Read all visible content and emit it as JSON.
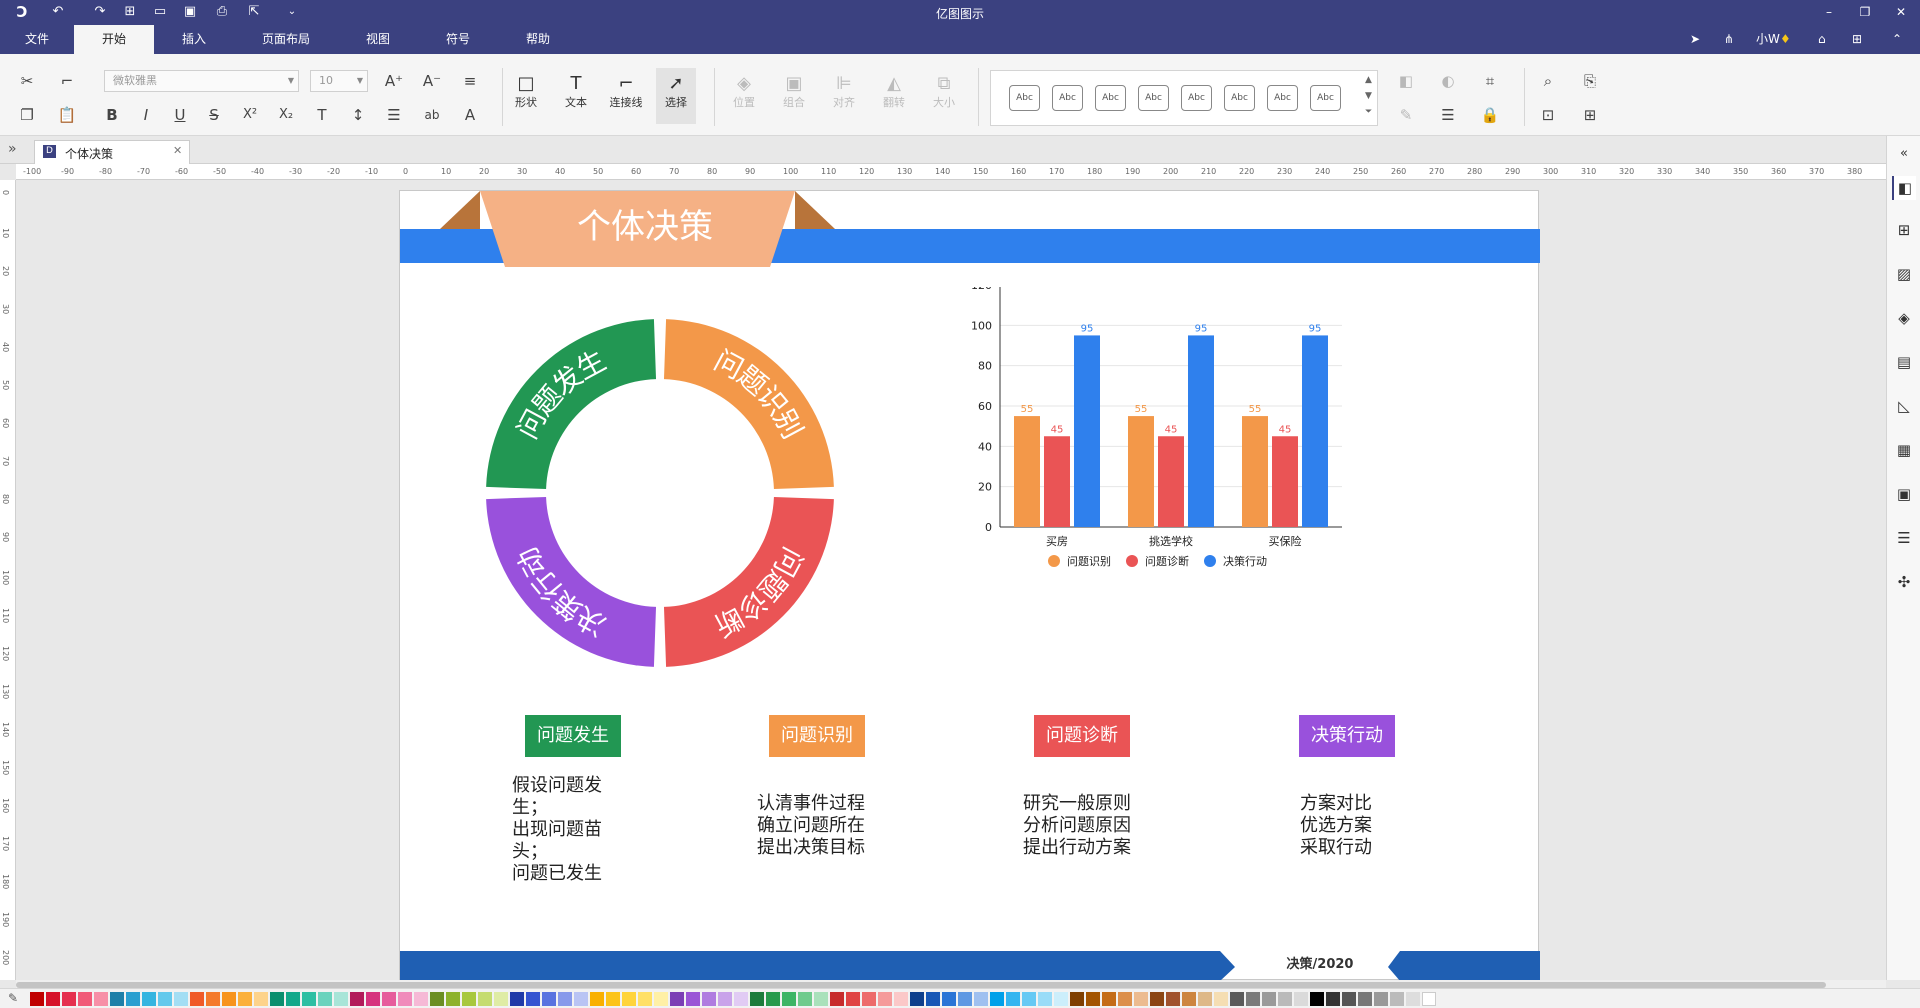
{
  "app": {
    "title": "亿图图示"
  },
  "menu": {
    "tabs": [
      "文件",
      "开始",
      "插入",
      "页面布局",
      "视图",
      "符号",
      "帮助"
    ],
    "active": "开始"
  },
  "user": {
    "name": "小W"
  },
  "ribbon": {
    "font_name": "微软雅黑",
    "font_size": "10",
    "big_buttons": [
      "形状",
      "文本",
      "连接线",
      "选择",
      "位置",
      "组合",
      "对齐",
      "翻转",
      "大小"
    ],
    "style_samples": [
      "Abc",
      "Abc",
      "Abc",
      "Abc",
      "Abc",
      "Abc",
      "Abc",
      "Abc"
    ]
  },
  "doc_tab": {
    "label": "个体决策"
  },
  "ruler": {
    "h": [
      "-100",
      "-90",
      "-80",
      "-70",
      "-60",
      "-50",
      "-40",
      "-30",
      "-20",
      "-10",
      "0",
      "10",
      "20",
      "30",
      "40",
      "50",
      "60",
      "70",
      "80",
      "90",
      "100",
      "110",
      "120",
      "130",
      "140",
      "150",
      "160",
      "170",
      "180",
      "190",
      "200",
      "210",
      "220",
      "230",
      "240",
      "250",
      "260",
      "270",
      "280",
      "290",
      "300",
      "310",
      "320",
      "330",
      "340",
      "350",
      "360",
      "370",
      "380"
    ],
    "v": [
      "0",
      "10",
      "20",
      "30",
      "40",
      "50",
      "60",
      "70",
      "80",
      "90",
      "100",
      "110",
      "120",
      "130",
      "140",
      "150",
      "160",
      "170",
      "180",
      "190",
      "200"
    ]
  },
  "diagram": {
    "title": "个体决策",
    "footer": "决策/2020",
    "ring": [
      "问题发生",
      "问题识别",
      "问题诊断",
      "决策行动"
    ],
    "ring_colors": [
      "#229753",
      "#f39849",
      "#ea5455",
      "#9951dc"
    ],
    "stages": [
      {
        "label": "问题发生",
        "color": "#229753",
        "desc": "假设问题发\n生；\n出现问题苗\n头；\n问题已发生"
      },
      {
        "label": "问题识别",
        "color": "#f39849",
        "desc": "认清事件过程\n确立问题所在\n提出决策目标"
      },
      {
        "label": "问题诊断",
        "color": "#ea5455",
        "desc": "研究一般原则\n分析问题原因\n提出行动方案"
      },
      {
        "label": "决策行动",
        "color": "#9951dc",
        "desc": "方案对比\n优选方案\n采取行动"
      }
    ]
  },
  "chart_data": {
    "type": "bar",
    "categories": [
      "买房",
      "挑选学校",
      "买保险"
    ],
    "series": [
      {
        "name": "问题识别",
        "color": "#f39849",
        "values": [
          55,
          55,
          55
        ]
      },
      {
        "name": "问题诊断",
        "color": "#ea5455",
        "values": [
          45,
          45,
          45
        ]
      },
      {
        "name": "决策行动",
        "color": "#2f80ed",
        "values": [
          95,
          95,
          95
        ]
      }
    ],
    "ylim": [
      0,
      120
    ],
    "yticks": [
      "0",
      "20",
      "40",
      "60",
      "80",
      "100",
      "120"
    ],
    "grid": true,
    "legend": "bottom",
    "data_labels": true
  },
  "palette": [
    "#c00000",
    "#d6122a",
    "#e5304f",
    "#f15a78",
    "#f78fa7",
    "#1e7fa8",
    "#2a9fd0",
    "#35b5e0",
    "#63c9ec",
    "#a3def4",
    "#f05a28",
    "#f47a2c",
    "#f7941d",
    "#fbb03b",
    "#fdd38b",
    "#0a8f6e",
    "#12a88a",
    "#2dbfa3",
    "#6ad3bd",
    "#a8e5d8",
    "#b21b5a",
    "#d6337e",
    "#e65d9c",
    "#f08bbb",
    "#f6b9d6",
    "#6b8e23",
    "#8db22c",
    "#a8c83e",
    "#c5dc70",
    "#dfeca5",
    "#1f3aa8",
    "#3454d1",
    "#5973e0",
    "#8799eb",
    "#b9c4f4",
    "#f9b000",
    "#fcc419",
    "#ffd43b",
    "#ffe066",
    "#fff0a6",
    "#7b3fb5",
    "#9a55d6",
    "#b07ce0",
    "#c9a3ea",
    "#e1cbf4",
    "#1c7c3c",
    "#279a4d",
    "#3db566",
    "#6fcb8d",
    "#a9e1bb",
    "#c72c2c",
    "#e04444",
    "#ed6b6b",
    "#f59a9a",
    "#fbc8c8",
    "#0e3f8c",
    "#1757b6",
    "#2a74d6",
    "#5e98e3",
    "#9fc0f0",
    "#00a0e9",
    "#33b5f0",
    "#66c9f4",
    "#99dcf8",
    "#cceefb",
    "#7f3f00",
    "#a35400",
    "#c46c17",
    "#dc8f4b",
    "#ecbb8f",
    "#8b4513",
    "#a0522d",
    "#cd853f",
    "#deb887",
    "#f5deb3",
    "#5a5a5a",
    "#7a7a7a",
    "#9a9a9a",
    "#bababa",
    "#dadada",
    "#000000",
    "#333333",
    "#555555",
    "#777777",
    "#999999",
    "#bbbbbb",
    "#dddddd",
    "#ffffff"
  ]
}
